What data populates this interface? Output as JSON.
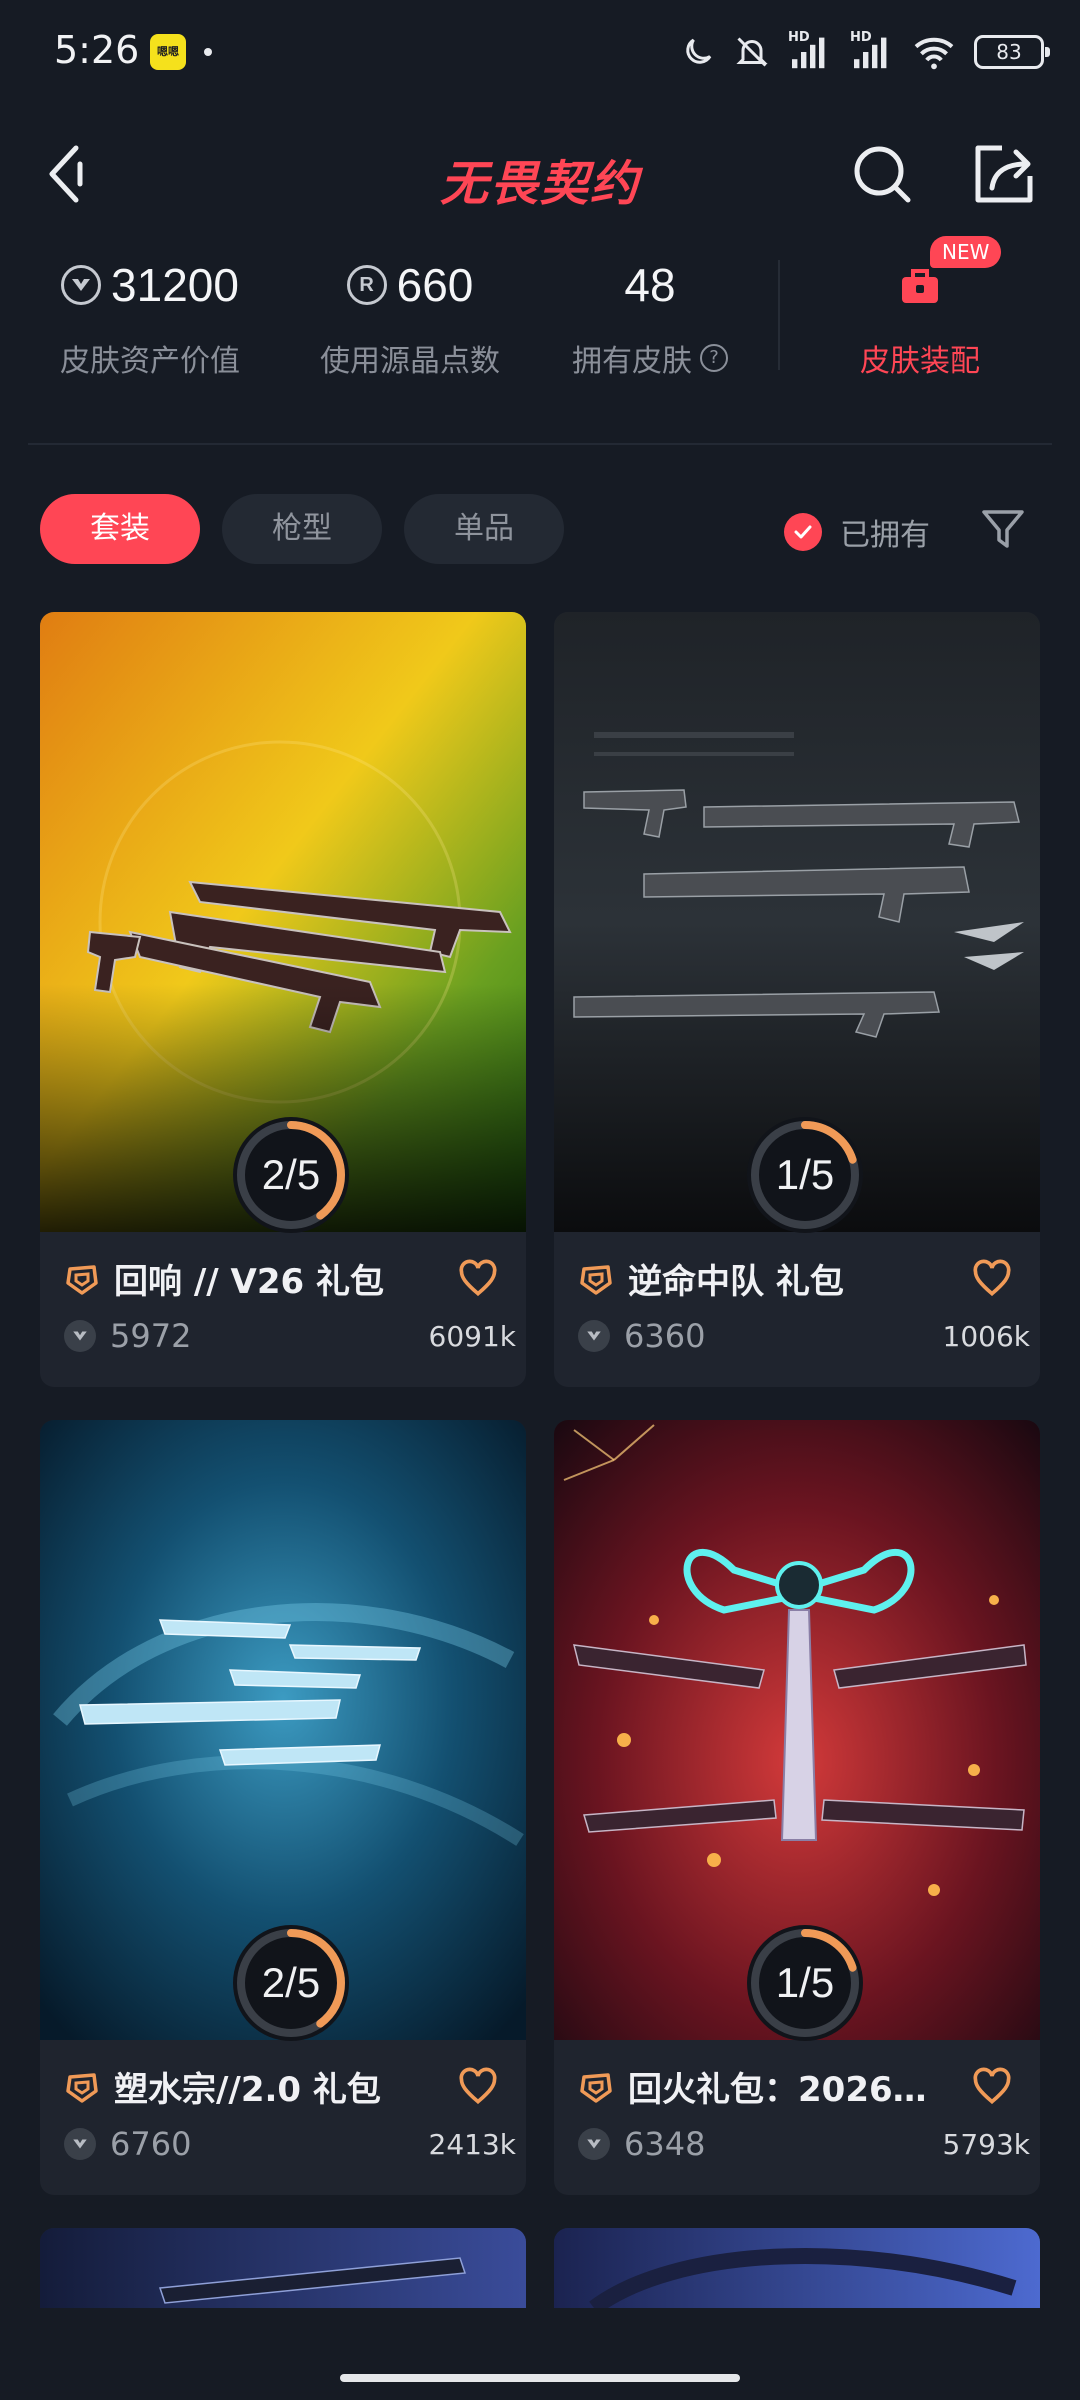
{
  "status_bar": {
    "time": "5:26",
    "app_badge": "嗯嗯",
    "network_1": "HD",
    "network_2": "HD",
    "battery": "83",
    "icons": [
      "moon-icon",
      "mute-bell-icon",
      "signal-icon",
      "signal-icon",
      "wifi-icon",
      "battery-icon"
    ]
  },
  "header": {
    "title": "无畏契约",
    "icons": [
      "back-arrow-icon",
      "search-icon",
      "share-icon"
    ]
  },
  "stats": [
    {
      "value": "31200",
      "label": "皮肤资产价值",
      "icon": "vp-icon"
    },
    {
      "value": "660",
      "label": "使用源晶点数",
      "icon": "radianite-icon"
    },
    {
      "value": "48",
      "label": "拥有皮肤",
      "icon": "help-icon"
    }
  ],
  "loadout": {
    "label": "皮肤装配",
    "badge": "NEW",
    "icon": "locker-icon"
  },
  "filters": {
    "tabs": [
      "套装",
      "枪型",
      "单品"
    ],
    "active_index": 0,
    "owned_label": "已拥有",
    "owned_checked": true
  },
  "bundles": [
    {
      "title": "回响 // V26 礼包",
      "price": "5972",
      "likes": "6091k",
      "progress": "2/5",
      "progress_value": 0.4,
      "favorited": false
    },
    {
      "title": "逆命中队 礼包",
      "price": "6360",
      "likes": "1006k",
      "progress": "1/5",
      "progress_value": 0.2,
      "favorited": false
    },
    {
      "title": "塑水宗//2.0 礼包",
      "price": "6760",
      "likes": "2413k",
      "progress": "2/5",
      "progress_value": 0.4,
      "favorited": false
    },
    {
      "title": "回火礼包：2026…",
      "price": "6348",
      "likes": "5793k",
      "progress": "1/5",
      "progress_value": 0.2,
      "favorited": false
    }
  ],
  "colors": {
    "accent": "#ff4655",
    "background": "#161b24",
    "card": "#1f242e",
    "progress": "#f09a57"
  }
}
